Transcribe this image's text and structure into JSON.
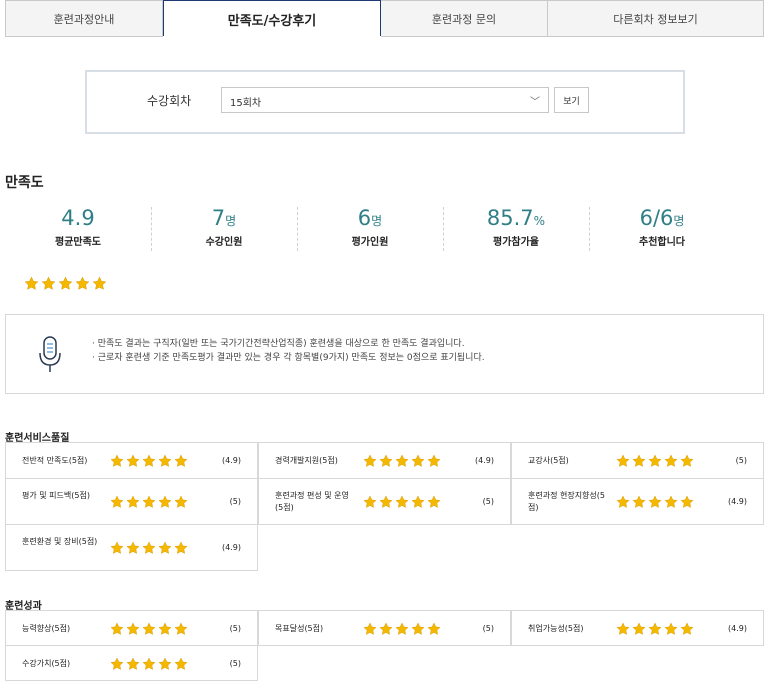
{
  "tabs": [
    {
      "label": "훈련과정안내"
    },
    {
      "label": "만족도/수강후기"
    },
    {
      "label": "훈련과정 문의"
    },
    {
      "label": "다른회차 정보보기"
    }
  ],
  "session": {
    "label": "수강회차",
    "selected": "15회차",
    "button": "보기"
  },
  "satisfaction": {
    "title": "만족도",
    "stats": [
      {
        "value": "4.9",
        "unit": "",
        "label": "평균만족도"
      },
      {
        "value": "7",
        "unit": "명",
        "label": "수강인원"
      },
      {
        "value": "6",
        "unit": "명",
        "label": "평가인원"
      },
      {
        "value": "85.7",
        "unit": "%",
        "label": "평가참가율"
      },
      {
        "value": "6/6",
        "unit": "명",
        "label": "추천합니다"
      }
    ],
    "star_rating": 4.9,
    "star_color": "#f5b800"
  },
  "notice": {
    "icon": "microphone-icon",
    "lines": [
      "· 만족도 결과는 구직자(일반 또는 국가기간전략산업직종) 훈련생을 대상으로 한 만족도 결과입니다.",
      "· 근로자 훈련생 기준 만족도평가 결과만 있는 경우 각 항목별(9가지) 만족도 정보는 0점으로 표기됩니다."
    ]
  },
  "service_quality": {
    "title": "훈련서비스품질",
    "items": [
      {
        "name": "전반적 만족도(5점)",
        "score": "(4.9)",
        "rating": 4.9
      },
      {
        "name": "경력개발지원(5점)",
        "score": "(4.9)",
        "rating": 4.9
      },
      {
        "name": "교강사(5점)",
        "score": "(5)",
        "rating": 5
      },
      {
        "name": "평가 및 피드백(5점)",
        "score": "(5)",
        "rating": 5
      },
      {
        "name": "훈련과정 편성 및 운영(5점)",
        "score": "(5)",
        "rating": 5
      },
      {
        "name": "훈련과정 현장지향성(5점)",
        "score": "(4.9)",
        "rating": 4.9
      },
      {
        "name": "훈련환경 및 장비(5점)",
        "score": "(4.9)",
        "rating": 4.9
      }
    ]
  },
  "outcomes": {
    "title": "훈련성과",
    "items": [
      {
        "name": "능력향상(5점)",
        "score": "(5)",
        "rating": 5
      },
      {
        "name": "목표달성(5점)",
        "score": "(5)",
        "rating": 5
      },
      {
        "name": "취업가능성(5점)",
        "score": "(4.9)",
        "rating": 4.9
      },
      {
        "name": "수강가치(5점)",
        "score": "(5)",
        "rating": 5
      }
    ]
  }
}
